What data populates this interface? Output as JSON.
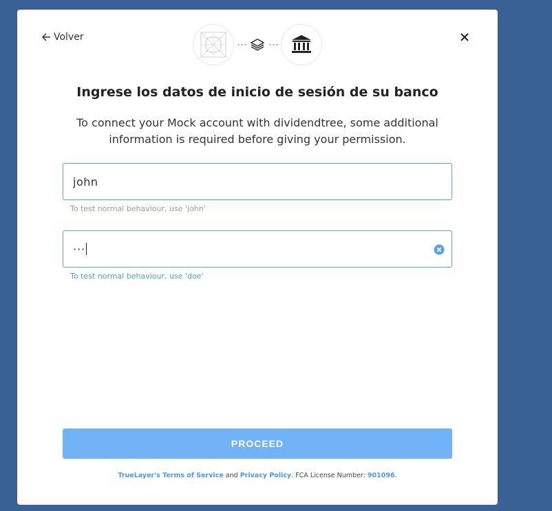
{
  "header": {
    "back_label": "Volver"
  },
  "title": "Ingrese los datos de inicio de sesión de su banco",
  "subtitle": "To connect your Mock account with dividendtree, some additional information is required before giving your permission.",
  "form": {
    "username": {
      "value": "john",
      "hint": "To test normal behaviour, use 'john'"
    },
    "password": {
      "masked_value": "···",
      "hint": "To test normal behaviour, use 'doe'"
    }
  },
  "proceed_label": "PROCEED",
  "footer": {
    "terms_link": "TrueLayer's Terms of Service",
    "and": "and",
    "privacy_link": "Privacy Policy",
    "license_text": ". FCA License Number:",
    "license_number": "901096",
    "end": "."
  },
  "icons": {
    "back": "arrow-left-icon",
    "close": "close-icon",
    "provider_logo": "mock-bank-logo-icon",
    "connector": "layers-icon",
    "bank": "bank-icon",
    "clear": "clear-circle-icon"
  },
  "colors": {
    "page_background": "#3a6195",
    "accent": "#5aa0ec",
    "button": "#72b3f7",
    "link": "#4b9ae6"
  }
}
